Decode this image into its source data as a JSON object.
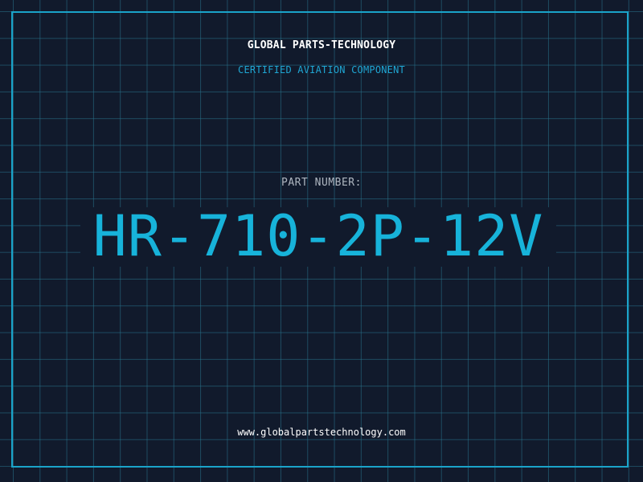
{
  "header": {
    "company": "GLOBAL PARTS-TECHNOLOGY",
    "tagline": "CERTIFIED AVIATION COMPONENT"
  },
  "part": {
    "label": "PART NUMBER:",
    "number": "HR-710-2P-12V"
  },
  "footer": {
    "website": "www.globalpartstechnology.com"
  },
  "colors": {
    "background": "#111a2c",
    "accent": "#1aa3c9",
    "grid": "#28738c"
  }
}
